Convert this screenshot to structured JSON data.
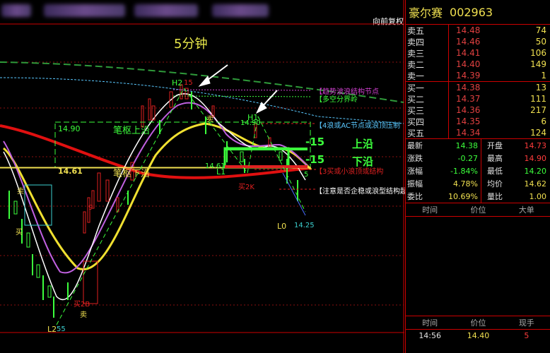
{
  "chart": {
    "mode_label": "向前复权",
    "period": "5分钟",
    "annotations": {
      "trend_node": "【趋势波浪结构节点",
      "bull_bear": "【多空分界岭",
      "wave4": "【4浪或AC节点或浪顶压制",
      "wave3": "【3买或小浪顶或结构",
      "watch": "【注意是否企稳或浪型结构起"
    },
    "level_labels": {
      "upper_price": "14.90",
      "lower_price": "14.61",
      "pen_upper": "笔枢上沿",
      "pen_lower": "笔枢下沿",
      "upper_edge": "上沿",
      "lower_edge": "下沿",
      "neg15_a": "-15",
      "neg15_b": "-15"
    },
    "points": {
      "h2": "H2",
      "h2_val": "15",
      "h1": "H1",
      "h1_val": "14.90",
      "l1": "L1",
      "l1_val": "14.61",
      "l0": "L0",
      "l0_val": "14.25",
      "l2": "L2",
      "l2_val": "55",
      "buy_2k": "买2K",
      "buy2b": "买2B",
      "sell_a": "卖",
      "sell_b": "卖",
      "sell_c": "卖",
      "buy_a": "买",
      "num_9": "9",
      "num_5": "5"
    }
  },
  "panel": {
    "stock_name": "豪尔赛",
    "stock_code": "002963",
    "asks": [
      {
        "label": "卖五",
        "price": "14.48",
        "vol": "74"
      },
      {
        "label": "卖四",
        "price": "14.46",
        "vol": "50"
      },
      {
        "label": "卖三",
        "price": "14.41",
        "vol": "106"
      },
      {
        "label": "卖二",
        "price": "14.40",
        "vol": "149"
      },
      {
        "label": "卖一",
        "price": "14.39",
        "vol": "1"
      }
    ],
    "bids": [
      {
        "label": "买一",
        "price": "14.38",
        "vol": "13"
      },
      {
        "label": "买二",
        "price": "14.37",
        "vol": "111"
      },
      {
        "label": "买三",
        "price": "14.36",
        "vol": "217"
      },
      {
        "label": "买四",
        "price": "14.35",
        "vol": "6"
      },
      {
        "label": "买五",
        "price": "14.34",
        "vol": "124"
      }
    ],
    "stats": [
      {
        "l1": "最新",
        "v1": "14.38",
        "c1": "green",
        "l2": "开盘",
        "v2": "14.73",
        "c2": "red"
      },
      {
        "l1": "涨跌",
        "v1": "-0.27",
        "c1": "green",
        "l2": "最高",
        "v2": "14.90",
        "c2": "red"
      },
      {
        "l1": "涨幅",
        "v1": "-1.84%",
        "c1": "green",
        "l2": "最低",
        "v2": "14.20",
        "c2": "green"
      },
      {
        "l1": "振幅",
        "v1": "4.78%",
        "c1": "yellow",
        "l2": "均价",
        "v2": "14.62",
        "c2": "yellow"
      },
      {
        "l1": "委比",
        "v1": "10.69%",
        "c1": "yellow",
        "l2": "量比",
        "v2": "1.00",
        "c2": "yellow"
      }
    ],
    "big_trades_header": {
      "time": "时间",
      "price": "价位",
      "big": "大单"
    },
    "ticks_header": {
      "time": "时间",
      "price": "价位",
      "hand": "现手"
    },
    "ticks": [
      {
        "time": "14:56",
        "price": "14.40",
        "hand": "5"
      }
    ],
    "colors": {
      "up": "#ff3c3c",
      "down": "#3cff3c",
      "border": "#cc0000",
      "accent": "#f0e050"
    }
  }
}
